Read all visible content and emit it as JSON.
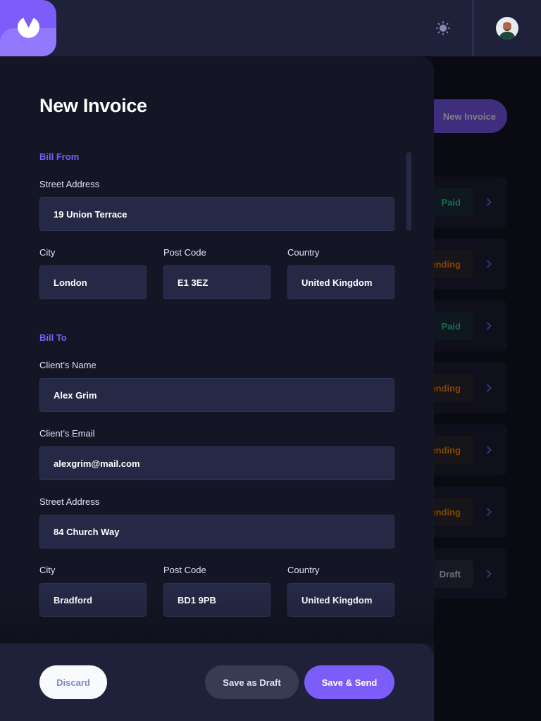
{
  "background_list": {
    "new_invoice_label": "New Invoice",
    "rows": [
      {
        "status": "Paid",
        "kind": "paid"
      },
      {
        "status": "ending",
        "kind": "pending"
      },
      {
        "status": "Paid",
        "kind": "paid"
      },
      {
        "status": "ending",
        "kind": "pending"
      },
      {
        "status": "ending",
        "kind": "pending"
      },
      {
        "status": "ending",
        "kind": "pending"
      },
      {
        "status": "Draft",
        "kind": "draft"
      }
    ]
  },
  "drawer": {
    "title": "New Invoice",
    "bill_from": {
      "heading": "Bill From",
      "street_label": "Street Address",
      "street": "19 Union Terrace",
      "city_label": "City",
      "city": "London",
      "postcode_label": "Post Code",
      "postcode": "E1 3EZ",
      "country_label": "Country",
      "country": "United Kingdom"
    },
    "bill_to": {
      "heading": "Bill To",
      "name_label": "Client’s Name",
      "name": "Alex Grim",
      "email_label": "Client’s Email",
      "email": "alexgrim@mail.com",
      "street_label": "Street Address",
      "street": "84 Church Way",
      "city_label": "City",
      "city": "Bradford",
      "postcode_label": "Post Code",
      "postcode": "BD1 9PB",
      "country_label": "Country",
      "country": "United Kingdom"
    }
  },
  "footer": {
    "discard": "Discard",
    "save_draft": "Save as Draft",
    "save_send": "Save & Send"
  },
  "icons": {
    "logo": "logo-icon",
    "theme": "sun-icon",
    "chevron": "chevron-right-icon"
  },
  "colors": {
    "accent": "#7c5dfa",
    "accent_light": "#9277ff",
    "paid": "#33d69f",
    "pending": "#ff8f00",
    "draft": "#dfe3fa"
  }
}
